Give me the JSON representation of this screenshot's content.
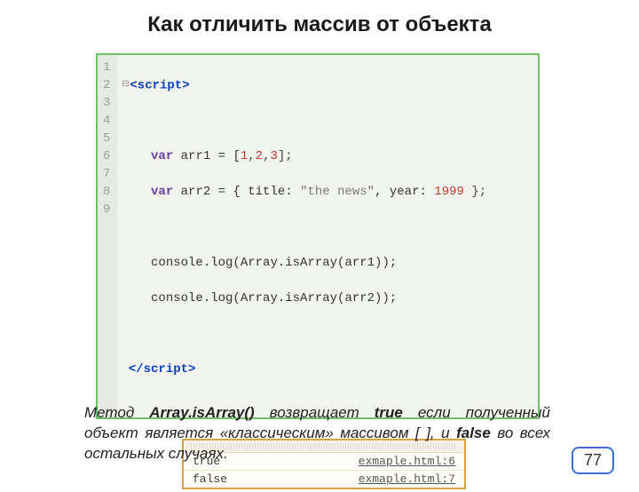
{
  "title": "Как отличить массив от объекта",
  "code": {
    "line_numbers": [
      "1",
      "2",
      "3",
      "4",
      "5",
      "6",
      "7",
      "8",
      "9"
    ],
    "l1_open": "<script>",
    "l3_var": "var",
    "l3_rest": " arr1 = [",
    "l3_n1": "1",
    "l3_c1": ",",
    "l3_n2": "2",
    "l3_c2": ",",
    "l3_n3": "3",
    "l3_end": "];",
    "l4_var": "var",
    "l4_mid": " arr2 = { title: ",
    "l4_str": "\"the news\"",
    "l4_mid2": ", year: ",
    "l4_num": "1999",
    "l4_end": " };",
    "l6": "console.log(Array.isArray(arr1));",
    "l7": "console.log(Array.isArray(arr2));",
    "l9_close": "</script>"
  },
  "console": {
    "rows": [
      {
        "out": "true",
        "src": "exmaple.html:6"
      },
      {
        "out": "false",
        "src": "exmaple.html:7"
      }
    ]
  },
  "paragraph": {
    "p1": "Метод ",
    "m1": "Array.isArray()",
    "p2": " возвращает ",
    "m2": "true",
    "p3": " если полученный объект является «классическим» массивом [ ], и ",
    "m3": "false",
    "p4": " во всех остальных случаях."
  },
  "page": "77"
}
